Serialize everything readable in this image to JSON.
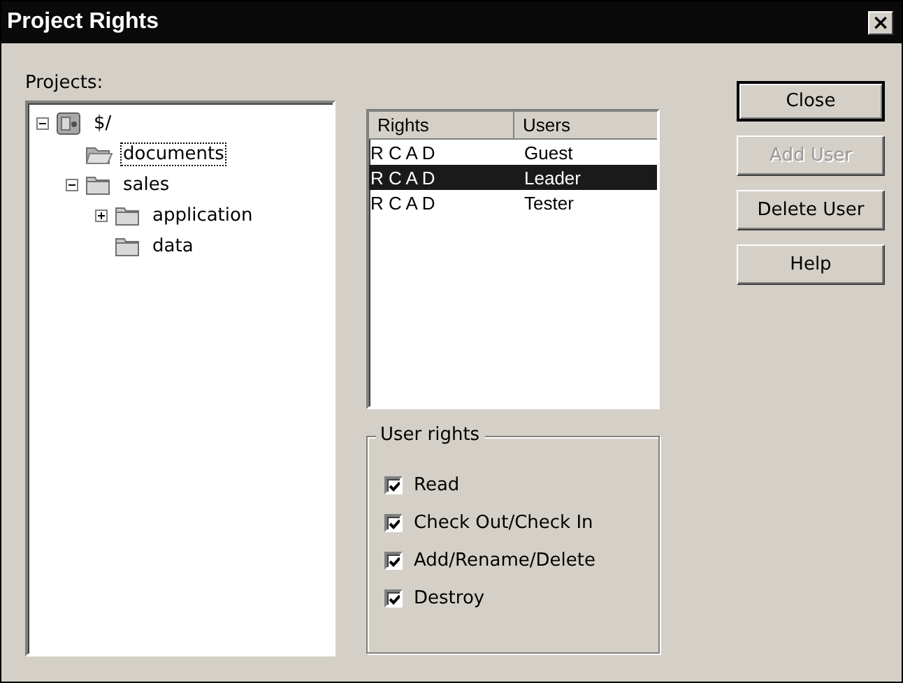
{
  "window": {
    "title": "Project Rights",
    "close_glyph": "×"
  },
  "projects": {
    "label": "Projects:",
    "tree": [
      {
        "label": "$/",
        "kind": "root",
        "expanded": true,
        "selected": false,
        "children": [
          {
            "label": "documents",
            "kind": "folder",
            "selected": true
          },
          {
            "label": "sales",
            "kind": "folder",
            "expanded": true,
            "selected": false,
            "children": [
              {
                "label": "application",
                "kind": "folder",
                "expanded": false,
                "selected": false
              },
              {
                "label": "data",
                "kind": "folder",
                "selected": false
              }
            ]
          }
        ]
      }
    ]
  },
  "users_list": {
    "columns": [
      "Rights",
      "Users"
    ],
    "rows": [
      {
        "rights": "R C A D",
        "user": "Guest",
        "selected": false
      },
      {
        "rights": "R C A D",
        "user": "Leader",
        "selected": true
      },
      {
        "rights": "R C A D",
        "user": "Tester",
        "selected": false
      }
    ]
  },
  "user_rights": {
    "label": "User rights",
    "options": [
      {
        "label": "Read",
        "checked": true
      },
      {
        "label": "Check Out/Check In",
        "checked": true
      },
      {
        "label": "Add/Rename/Delete",
        "checked": true
      },
      {
        "label": "Destroy",
        "checked": true
      }
    ]
  },
  "buttons": [
    {
      "label": "Close",
      "default": true,
      "disabled": false
    },
    {
      "label": "Add User",
      "default": false,
      "disabled": true
    },
    {
      "label": "Delete User",
      "default": false,
      "disabled": false
    },
    {
      "label": "Help",
      "default": false,
      "disabled": false
    }
  ]
}
